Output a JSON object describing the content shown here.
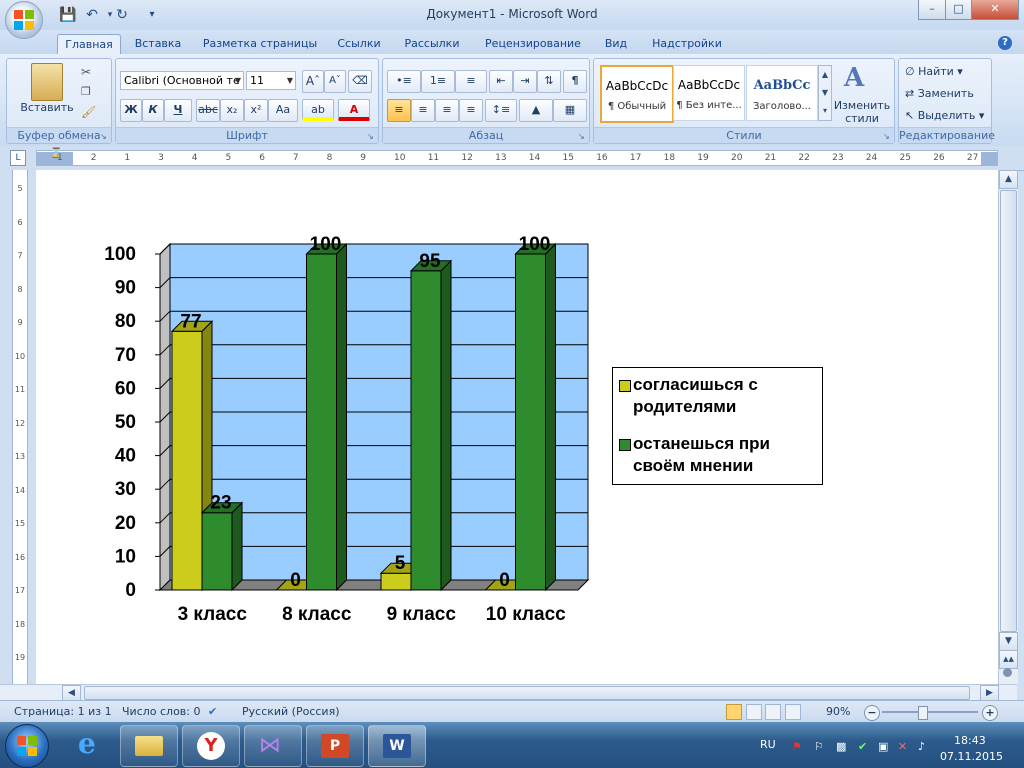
{
  "window": {
    "title": "Документ1 - Microsoft Word",
    "minimize": "–",
    "maximize": "□",
    "close": "✕"
  },
  "tabs": [
    "Главная",
    "Вставка",
    "Разметка страницы",
    "Ссылки",
    "Рассылки",
    "Рецензирование",
    "Вид",
    "Надстройки"
  ],
  "ribbon": {
    "clipboard": {
      "paste": "Вставить",
      "label": "Буфер обмена"
    },
    "font": {
      "name": "Calibri (Основной те",
      "size": "11",
      "label": "Шрифт",
      "bold": "Ж",
      "italic": "К",
      "underline": "Ч",
      "strike": "abc",
      "sub": "x₂",
      "sup": "x²",
      "case": "Aa"
    },
    "paragraph": {
      "label": "Абзац"
    },
    "styles": {
      "label": "Стили",
      "tiles": [
        {
          "preview": "AaBbCcDc",
          "name": "¶ Обычный"
        },
        {
          "preview": "AaBbCcDc",
          "name": "¶ Без инте..."
        },
        {
          "preview": "AaBbCc",
          "name": "Заголово..."
        }
      ],
      "change": "Изменить стили"
    },
    "editing": {
      "find": "Найти",
      "replace": "Заменить",
      "select": "Выделить",
      "label": "Редактирование"
    }
  },
  "ruler_numbers": [
    "1",
    "2",
    "1",
    "3",
    "4",
    "5",
    "6",
    "7",
    "8",
    "9",
    "10",
    "11",
    "12",
    "13",
    "14",
    "15",
    "16",
    "17",
    "18",
    "19",
    "20",
    "21",
    "22",
    "23",
    "24",
    "25",
    "26",
    "27"
  ],
  "vruler_numbers": [
    "5",
    "6",
    "7",
    "8",
    "9",
    "10",
    "11",
    "12",
    "13",
    "14",
    "15",
    "16",
    "17",
    "18",
    "19"
  ],
  "chart_data": {
    "type": "bar",
    "categories": [
      "3 класс",
      "8 класс",
      "9 класс",
      "10 класс"
    ],
    "series": [
      {
        "name": "согласишься с родителями",
        "color": "#cccc1c",
        "values": [
          77,
          0,
          5,
          0
        ]
      },
      {
        "name": "останешься при своём мнении",
        "color": "#2e8b2e",
        "values": [
          23,
          100,
          95,
          100
        ]
      }
    ],
    "ylim": [
      0,
      100
    ],
    "yticks": [
      "0",
      "10",
      "20",
      "30",
      "40",
      "50",
      "60",
      "70",
      "80",
      "90",
      "100"
    ],
    "data_labels": [
      [
        "77",
        "0",
        "5",
        "0"
      ],
      [
        "23",
        "100",
        "95",
        "100"
      ]
    ],
    "grid": true,
    "legend_position": "right",
    "plot_color": "#99ccff"
  },
  "legend": {
    "item1_line1": "согласишься с",
    "item1_line2": "родителями",
    "item2_line1": "останешься при",
    "item2_line2": "своём мнении"
  },
  "status": {
    "page": "Страница: 1 из 1",
    "words": "Число слов: 0",
    "lang": "Русский (Россия)",
    "zoom": "90%"
  },
  "taskbar": {
    "lang": "RU",
    "time": "18:43",
    "date": "07.11.2015"
  }
}
